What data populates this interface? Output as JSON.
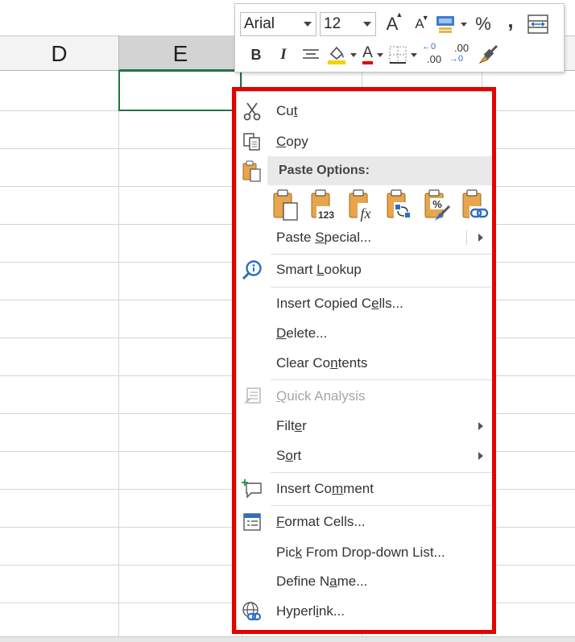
{
  "sheet": {
    "columns": [
      {
        "label": "D",
        "selected": false
      },
      {
        "label": "E",
        "selected": true
      }
    ]
  },
  "mini_toolbar": {
    "font_name": "Arial",
    "font_size": "12",
    "buttons": {
      "grow_font": "A",
      "shrink_font": "A",
      "percent": "%",
      "comma": ",",
      "bold": "B",
      "italic": "I",
      "font_color": "A",
      "inc_decimal": ".00",
      "dec_decimal": ".00"
    }
  },
  "context_menu": {
    "cut": {
      "before": "Cu",
      "key": "t",
      "after": ""
    },
    "copy": {
      "before": "",
      "key": "C",
      "after": "opy"
    },
    "paste_options": "Paste Options:",
    "paste_icon_labels": {
      "values": "123",
      "formulas": "fx",
      "formatting": "%"
    },
    "paste_special": {
      "before": "Paste ",
      "key": "S",
      "after": "pecial..."
    },
    "smart_lookup": {
      "before": "Smart ",
      "key": "L",
      "after": "ookup"
    },
    "insert_copied_cells": {
      "before": "Insert Copied C",
      "key": "e",
      "after": "lls..."
    },
    "delete": {
      "before": "",
      "key": "D",
      "after": "elete..."
    },
    "clear_contents": {
      "before": "Clear Co",
      "key": "n",
      "after": "tents"
    },
    "quick_analysis": {
      "before": "",
      "key": "Q",
      "after": "uick Analysis"
    },
    "filter": {
      "before": "Filt",
      "key": "e",
      "after": "r"
    },
    "sort": {
      "before": "S",
      "key": "o",
      "after": "rt"
    },
    "insert_comment": {
      "before": "Insert Co",
      "key": "m",
      "after": "ment"
    },
    "format_cells": {
      "before": "",
      "key": "F",
      "after": "ormat Cells..."
    },
    "pick_from_list": {
      "before": "Pic",
      "key": "k",
      "after": " From Drop-down List..."
    },
    "define_name": {
      "before": "Define N",
      "key": "a",
      "after": "me..."
    },
    "hyperlink": {
      "before": "Hyperl",
      "key": "i",
      "after": "nk..."
    }
  },
  "colors": {
    "highlight_frame": "#e60000",
    "active_cell_border": "#217346",
    "paste_clipboard": "#e8a54b",
    "lookup_blue": "#2b6ec6"
  }
}
